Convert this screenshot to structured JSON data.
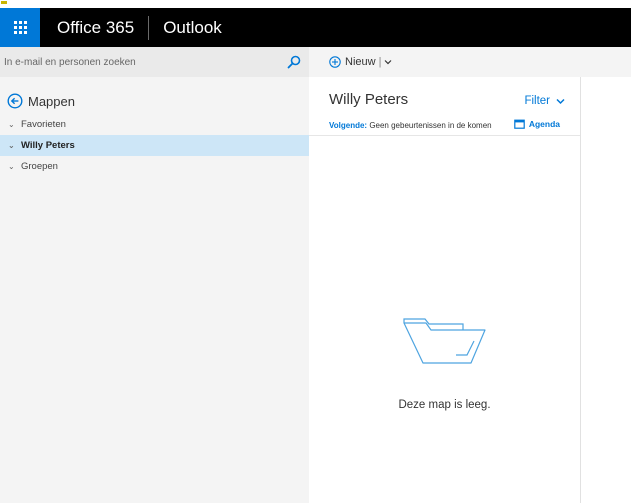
{
  "header": {
    "brand": "Office 365",
    "app": "Outlook"
  },
  "search": {
    "placeholder": "In e-mail en personen zoeken"
  },
  "commands": {
    "new_label": "Nieuw",
    "separator": "|"
  },
  "folders": {
    "heading": "Mappen",
    "items": [
      {
        "label": "Favorieten",
        "selected": false
      },
      {
        "label": "Willy Peters",
        "selected": true
      },
      {
        "label": "Groepen",
        "selected": false
      }
    ]
  },
  "message_list": {
    "title": "Willy Peters",
    "filter_label": "Filter",
    "next_key": "Volgende:",
    "next_value": "Geen gebeurtenissen in de komen",
    "agenda_label": "Agenda",
    "empty_text": "Deze map is leeg."
  },
  "colors": {
    "accent": "#0078d7",
    "topbar": "#000000",
    "selected_row": "#cde6f7",
    "pane_bg": "#f4f4f4"
  },
  "icons": [
    "app-launcher-icon",
    "search-icon",
    "plus-circle-icon",
    "chevron-down-icon",
    "back-arrow-icon",
    "calendar-icon",
    "empty-folder-icon"
  ]
}
